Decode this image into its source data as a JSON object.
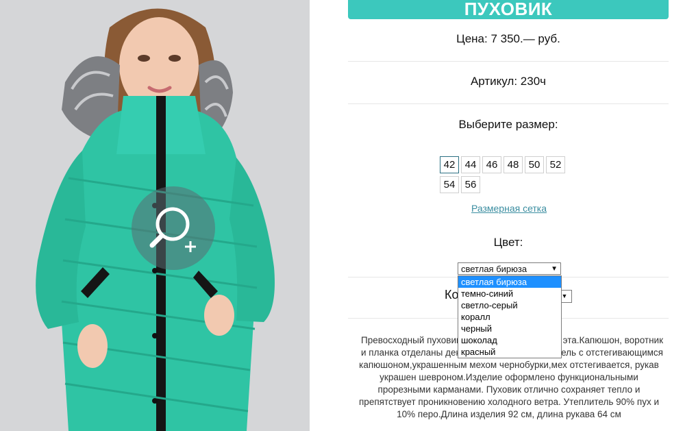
{
  "product": {
    "title": "ПУХОВИК",
    "price": "Цена: 7 350.— руб.",
    "article": "Артикул: 230ч",
    "size_label": "Выберите размер:",
    "sizes": [
      "42",
      "44",
      "46",
      "48",
      "50",
      "52",
      "54",
      "56"
    ],
    "selected_size": "42",
    "size_chart_link": "Размерная сетка",
    "color_label": "Цвет:",
    "color_selected": "светлая бирюза",
    "color_options": [
      "светлая бирюза",
      "темно-синий",
      "светло-серый",
      "коралл",
      "черный",
      "шоколад",
      "красный"
    ],
    "quantity_label_partial": "Ко",
    "description": "Превосходный пуховик ... эта.Капюшон, воротник и планка отделаны дек... ель с отстегивающимся капюшоном,украшенным мехом чернобурки,мех отстегивается, рукав украшен шевроном.Изделие оформлено функциональными прорезными карманами. Пуховик отлично сохраняет тепло и препятствует проникновению холодного ветра. Утеплитель 90% пух и 10% перо.Длина изделия 92 см, длина рукава 64 см",
    "description_lines": [
      "Превосходный пуховик",
      "эта.Капюшон, воротник",
      "и планка отделаны деко",
      "ель с отстегивающимся",
      "капюшоном,украшенным мехом чернобурки,мех отстегивается, рукав",
      "украшен шевроном.Изделие оформлено функциональными",
      "прорезными карманами. Пуховик отлично сохраняет тепло и",
      "препятствует проникновению холодного ветра. Утеплитель 90% пух и",
      "10% перо.Длина изделия 92 см, длина рукава 64 см"
    ]
  },
  "colors": {
    "accent": "#3cc8bd",
    "link": "#3a8da0",
    "jacket": "#2fc4a4",
    "dropdown_highlight": "#1e90ff"
  },
  "icons": {
    "zoom": "zoom-in-magnifier-icon"
  }
}
